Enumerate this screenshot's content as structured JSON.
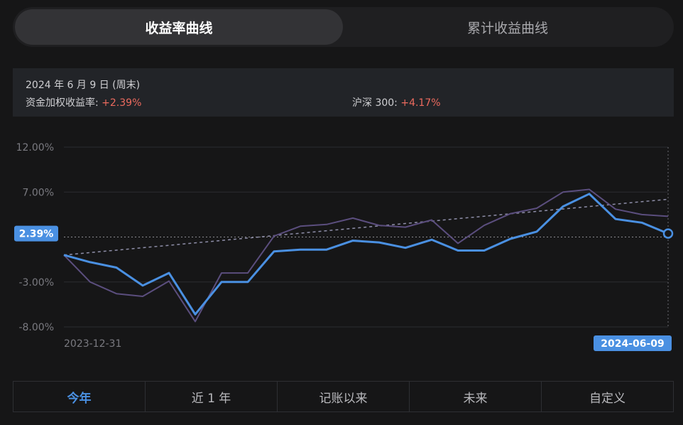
{
  "tabs": [
    {
      "label": "收益率曲线",
      "active": true
    },
    {
      "label": "累计收益曲线",
      "active": false
    }
  ],
  "info": {
    "date": "2024 年 6 月 9 日 (周末)",
    "fund_label": "资金加权收益率:",
    "fund_value": "+2.39%",
    "index_label": "沪深 300:",
    "index_value": "+4.17%"
  },
  "ranges": [
    {
      "label": "今年",
      "active": true
    },
    {
      "label": "近 1 年",
      "active": false
    },
    {
      "label": "记账以来",
      "active": false
    },
    {
      "label": "未来",
      "active": false
    },
    {
      "label": "自定义",
      "active": false
    }
  ],
  "chart_data": {
    "type": "line",
    "ylim": [
      -8,
      12
    ],
    "y_ticks": [
      12,
      7,
      2,
      -3,
      -8
    ],
    "y_tick_labels": [
      "12.00%",
      "7.00%",
      "2.39%",
      "-3.00%",
      "-8.00%"
    ],
    "x_start_label": "2023-12-31",
    "x_end_label": "2024-06-09",
    "current_value_label": "2.39%",
    "series": [
      {
        "color": "#4a90e2",
        "values": [
          0,
          -0.8,
          -1.4,
          -3.4,
          -2.0,
          -6.6,
          -3.0,
          -3.0,
          0.4,
          0.6,
          0.6,
          1.6,
          1.4,
          0.8,
          1.7,
          0.5,
          0.5,
          1.8,
          2.6,
          5.4,
          6.8,
          4.0,
          3.6,
          2.39
        ]
      },
      {
        "color": "#5b4e7e",
        "values": [
          0,
          -3.0,
          -4.3,
          -4.6,
          -2.9,
          -7.4,
          -2.0,
          -2.0,
          2.1,
          3.2,
          3.4,
          4.1,
          3.3,
          3.1,
          3.9,
          1.3,
          3.3,
          4.6,
          5.2,
          7.0,
          7.3,
          5.1,
          4.5,
          4.3
        ]
      }
    ],
    "trend_line": {
      "color": "#8e8ea8",
      "start": 0,
      "end": 6.2
    },
    "grid": true
  }
}
